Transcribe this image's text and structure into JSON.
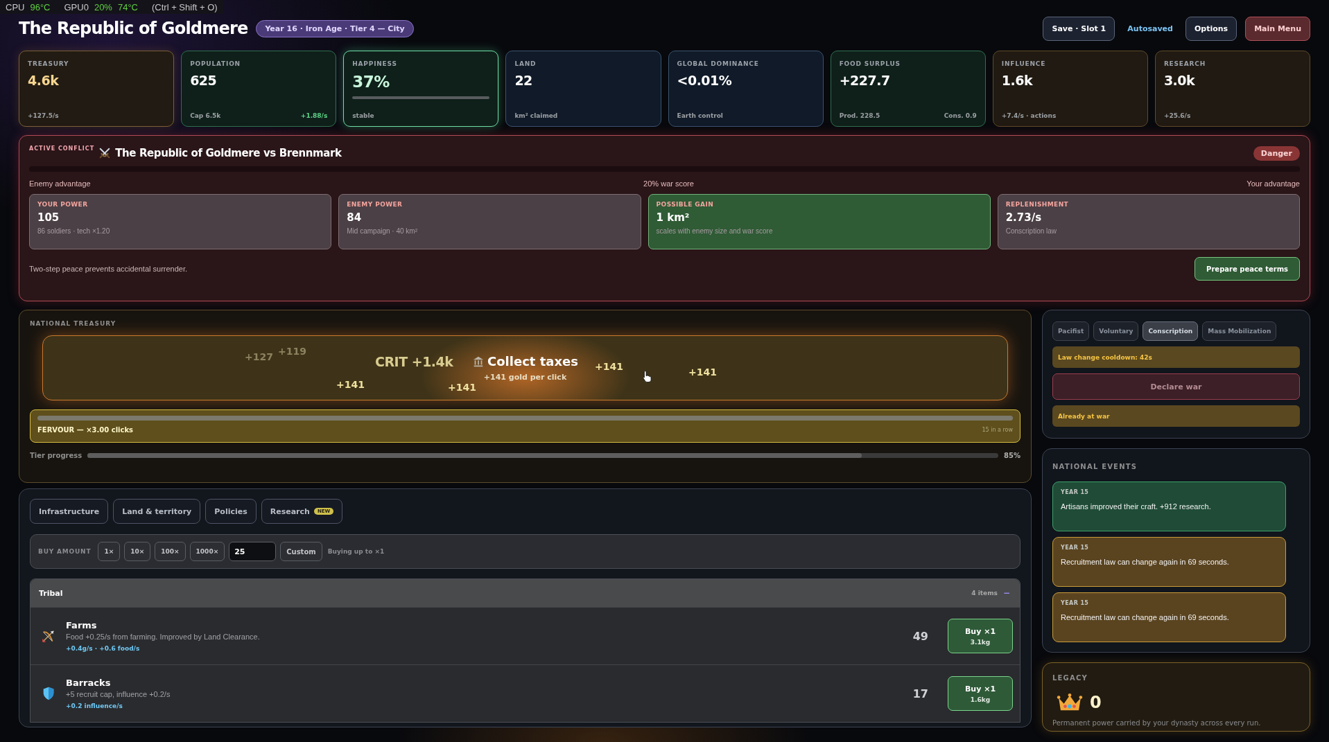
{
  "overlay": {
    "cpu_label": "CPU",
    "cpu_temp": "96°C",
    "gpu_label": "GPU0",
    "gpu_load": "20%",
    "gpu_temp": "74°C",
    "hotkey": "(Ctrl + Shift + O)"
  },
  "header": {
    "title": "The Republic of Goldmere",
    "era": "Year 16 · Iron Age · Tier 4 — City",
    "save": "Save · Slot 1",
    "autosave": "Autosaved",
    "options": "Options",
    "menu": "Main Menu"
  },
  "stats": [
    {
      "label": "TREASURY",
      "value": "4.6k",
      "sub": "+127.5/s",
      "kind": "treasury"
    },
    {
      "label": "POPULATION",
      "value": "625",
      "sub": "Cap 6.5k",
      "sub_right": {
        "text": "+1.88/s",
        "positive": true
      },
      "kind": "green"
    },
    {
      "label": "HAPPINESS",
      "value": "37%",
      "sub": "stable",
      "kind": "happy"
    },
    {
      "label": "LAND",
      "value": "22",
      "sub": "km² claimed",
      "kind": "blue"
    },
    {
      "label": "GLOBAL DOMINANCE",
      "value": "<0.01%",
      "sub": "Earth control",
      "kind": "blue"
    },
    {
      "label": "FOOD SURPLUS",
      "value": "+227.7",
      "sub": "Prod. 228.5",
      "sub_right": {
        "text": "Cons. 0.9",
        "positive": false
      },
      "kind": "green"
    },
    {
      "label": "INFLUENCE",
      "value": "1.6k",
      "sub": "+7.4/s · actions",
      "kind": "amber"
    },
    {
      "label": "RESEARCH",
      "value": "3.0k",
      "sub": "+25.6/s",
      "kind": "amber"
    }
  ],
  "conflict": {
    "label": "ACTIVE CONFLICT",
    "title": "The Republic of Goldmere vs Brennmark",
    "badge": "Danger",
    "left_label": "Enemy advantage",
    "center_label": "20% war score",
    "right_label": "Your advantage",
    "cards": [
      {
        "label": "YOUR POWER",
        "value": "105",
        "sub": "86 soldiers · tech ×1.20",
        "kind": "neutral"
      },
      {
        "label": "ENEMY POWER",
        "value": "84",
        "sub": "Mid campaign · 40 km²",
        "kind": "neutral"
      },
      {
        "label": "POSSIBLE GAIN",
        "value": "1 km²",
        "sub": "scales with enemy size and war score",
        "kind": "gain"
      },
      {
        "label": "REPLENISHMENT",
        "value": "2.73/s",
        "sub": "Conscription law",
        "kind": "neutral"
      }
    ],
    "note": "Two-step peace prevents accidental surrender.",
    "action": "Prepare peace terms"
  },
  "treasury": {
    "label": "NATIONAL TREASURY",
    "collect_title": "Collect taxes",
    "collect_sub": "+141 gold per click",
    "floaters": [
      {
        "text": "+127",
        "kind": "faded"
      },
      {
        "text": "+119",
        "kind": "faded"
      },
      {
        "text": "CRIT +1.4k",
        "kind": "crit"
      },
      {
        "text": "+141",
        "kind": "normal"
      },
      {
        "text": "+141",
        "kind": "normal"
      },
      {
        "text": "+141",
        "kind": "normal"
      },
      {
        "text": "+141",
        "kind": "normal"
      }
    ],
    "fervour": {
      "label": "FERVOUR — ×3.00 clicks",
      "streak": "15 in a row",
      "level": 1
    },
    "tier": {
      "label": "Tier progress",
      "level": 0.85,
      "reading": "85%"
    }
  },
  "actions": {
    "tabs": [
      {
        "label": "Infrastructure",
        "selected": false
      },
      {
        "label": "Land & territory",
        "selected": false
      },
      {
        "label": "Policies",
        "selected": false
      },
      {
        "label": "Research",
        "selected": false,
        "badge": "NEW"
      }
    ],
    "buy": {
      "label": "BUY AMOUNT",
      "options": [
        {
          "label": "1×",
          "selected": false
        },
        {
          "label": "10×",
          "selected": false
        },
        {
          "label": "100×",
          "selected": false
        },
        {
          "label": "1000×",
          "selected": false
        }
      ],
      "input_value": "25",
      "custom": "Custom",
      "note": "Buying up to ×1"
    },
    "group": {
      "title": "Tribal",
      "count": "4 items",
      "toggle": "−",
      "items": [
        {
          "name": "Farms",
          "desc": "Food +0.25/s from farming. Improved by Land Clearance.",
          "yield": "+0.4g/s · +0.6 food/s",
          "owned": "49",
          "buy": "Buy ×1",
          "cost": "3.1kg"
        },
        {
          "name": "Barracks",
          "desc": "+5 recruit cap, influence +0.2/s",
          "yield": "+0.2 influence/s",
          "owned": "17",
          "buy": "Buy ×1",
          "cost": "1.6kg"
        }
      ]
    }
  },
  "recruitment": {
    "laws": [
      {
        "label": "Pacifist",
        "selected": false
      },
      {
        "label": "Voluntary",
        "selected": false
      },
      {
        "label": "Conscription",
        "selected": true
      },
      {
        "label": "Mass Mobilization",
        "selected": false
      }
    ],
    "cooldown": "Law change cooldown: 42s",
    "declare": {
      "label": "Declare war",
      "disabled": true
    },
    "war_note": "Already at war"
  },
  "events": {
    "label": "NATIONAL EVENTS",
    "items": [
      {
        "year": "YEAR 15",
        "text": "Artisans improved their craft. +912 research.",
        "kind": "good"
      },
      {
        "year": "YEAR 15",
        "text": "Recruitment law can change again in 69 seconds.",
        "kind": "warning"
      },
      {
        "year": "YEAR 15",
        "text": "Recruitment law can change again in 69 seconds.",
        "kind": "warning"
      }
    ]
  },
  "legacy": {
    "label": "LEGACY",
    "value": "0",
    "text": "Permanent power carried by your dynasty across every run."
  }
}
